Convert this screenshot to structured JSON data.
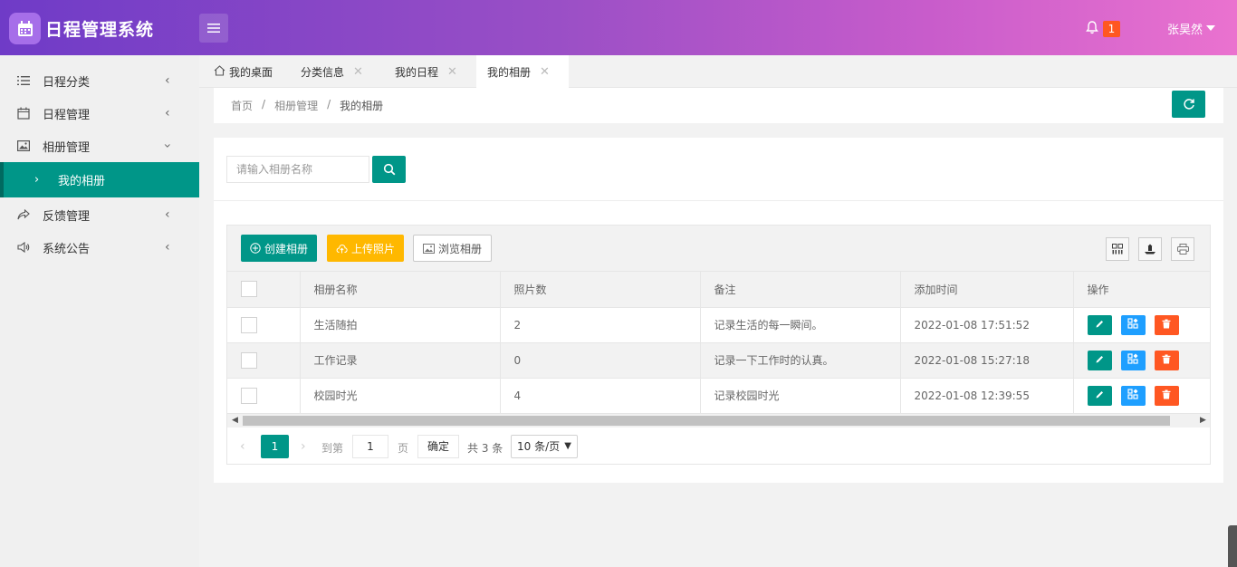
{
  "app": {
    "title": "日程管理系统"
  },
  "header": {
    "notification_count": "1",
    "username": "张昊然"
  },
  "sidebar": {
    "items": [
      {
        "label": "日程分类",
        "icon": "list-icon"
      },
      {
        "label": "日程管理",
        "icon": "calendar-icon"
      },
      {
        "label": "相册管理",
        "icon": "image-icon",
        "expanded": true
      },
      {
        "label": "反馈管理",
        "icon": "share-icon"
      },
      {
        "label": "系统公告",
        "icon": "speaker-icon"
      }
    ],
    "sub_item": {
      "label": "我的相册"
    }
  },
  "tabs": [
    {
      "label": "我的桌面",
      "icon": "home-icon"
    },
    {
      "label": "分类信息"
    },
    {
      "label": "我的日程"
    },
    {
      "label": "我的相册",
      "active": true
    }
  ],
  "breadcrumb": {
    "home": "首页",
    "parent": "相册管理",
    "current": "我的相册",
    "separator": "/"
  },
  "search": {
    "placeholder": "请输入相册名称"
  },
  "toolbar": {
    "create": "创建相册",
    "upload": "上传照片",
    "browse": "浏览相册"
  },
  "table": {
    "columns": [
      "相册名称",
      "照片数",
      "备注",
      "添加时间",
      "操作"
    ],
    "rows": [
      {
        "name": "生活随拍",
        "count": "2",
        "note": "记录生活的每一瞬间。",
        "time": "2022-01-08 17:51:52"
      },
      {
        "name": "工作记录",
        "count": "0",
        "note": "记录一下工作时的认真。",
        "time": "2022-01-08 15:27:18"
      },
      {
        "name": "校园时光",
        "count": "4",
        "note": "记录校园时光",
        "time": "2022-01-08 12:39:55"
      }
    ]
  },
  "pager": {
    "current_page": "1",
    "goto_label": "到第",
    "page_input": "1",
    "page_unit": "页",
    "confirm": "确定",
    "total": "共 3 条",
    "page_size": "10 条/页"
  },
  "colors": {
    "primary": "#009688",
    "warm": "#ffb800",
    "blue": "#1e9fff",
    "danger": "#ff5722"
  }
}
